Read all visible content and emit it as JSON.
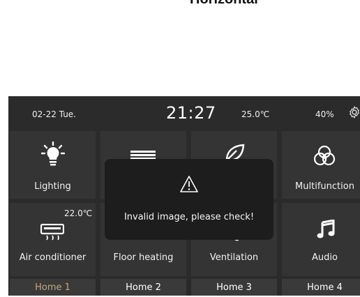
{
  "heading": "Horizontal",
  "status": {
    "date": "02-22  Tue.",
    "time": "21:27",
    "temperature": "25.0℃",
    "humidity": "40%"
  },
  "tiles": {
    "lighting": "Lighting",
    "multifunction": "Multifunction",
    "air_conditioner": "Air conditioner",
    "air_conditioner_temp": "22.0℃",
    "floor_heating": "Floor heating",
    "ventilation": "Ventilation",
    "audio": "Audio"
  },
  "tabs": [
    "Home 1",
    "Home 2",
    "Home 3",
    "Home 4"
  ],
  "active_tab": 0,
  "toast": {
    "message": "Invalid image, please check!"
  },
  "icons": {
    "gear": "gear-icon",
    "lighting": "lightbulb-icon",
    "curtain": "curtain-icon",
    "leaf": "leaf-icon",
    "multifunction": "rgb-circles-icon",
    "air_conditioner": "air-conditioner-icon",
    "floor_heating": "floor-heating-icon",
    "ventilation": "fan-icon",
    "audio": "music-note-icon",
    "warning": "warning-icon"
  },
  "colors": {
    "panel_bg": "#2b2b2b",
    "tile_bg": "#343434",
    "tab_bg": "#3a3a3a",
    "active_tab_text": "#c9a37a",
    "toast_bg": "#1d1d1d"
  }
}
